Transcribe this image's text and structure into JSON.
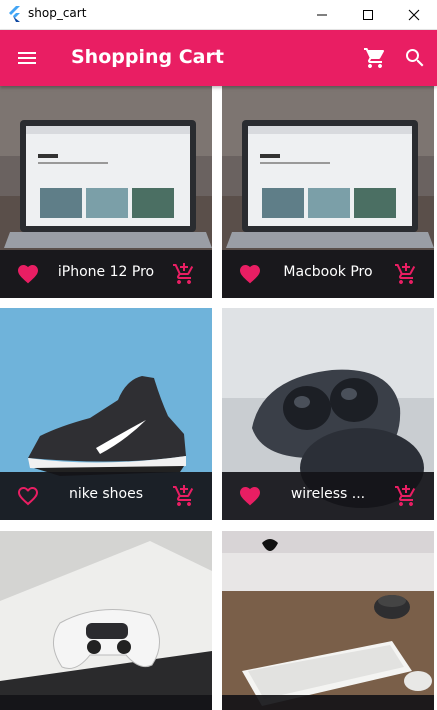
{
  "window": {
    "title": "shop_cart"
  },
  "appbar": {
    "title": "Shopping Cart"
  },
  "colors": {
    "accent": "#e91e63",
    "tile_footer": "#141418"
  },
  "icons": {
    "menu": "menu-icon",
    "cart": "cart-icon",
    "search": "search-icon",
    "favorite": "heart-icon",
    "add_to_cart": "add-shopping-cart-icon"
  },
  "products": [
    {
      "name": "iPhone 12 Pro",
      "favorite": true
    },
    {
      "name": "Macbook Pro",
      "favorite": true
    },
    {
      "name": "nike shoes",
      "favorite": false
    },
    {
      "name": "wireless ...",
      "favorite": true
    },
    {
      "name": "",
      "favorite": false
    },
    {
      "name": "",
      "favorite": false
    }
  ]
}
